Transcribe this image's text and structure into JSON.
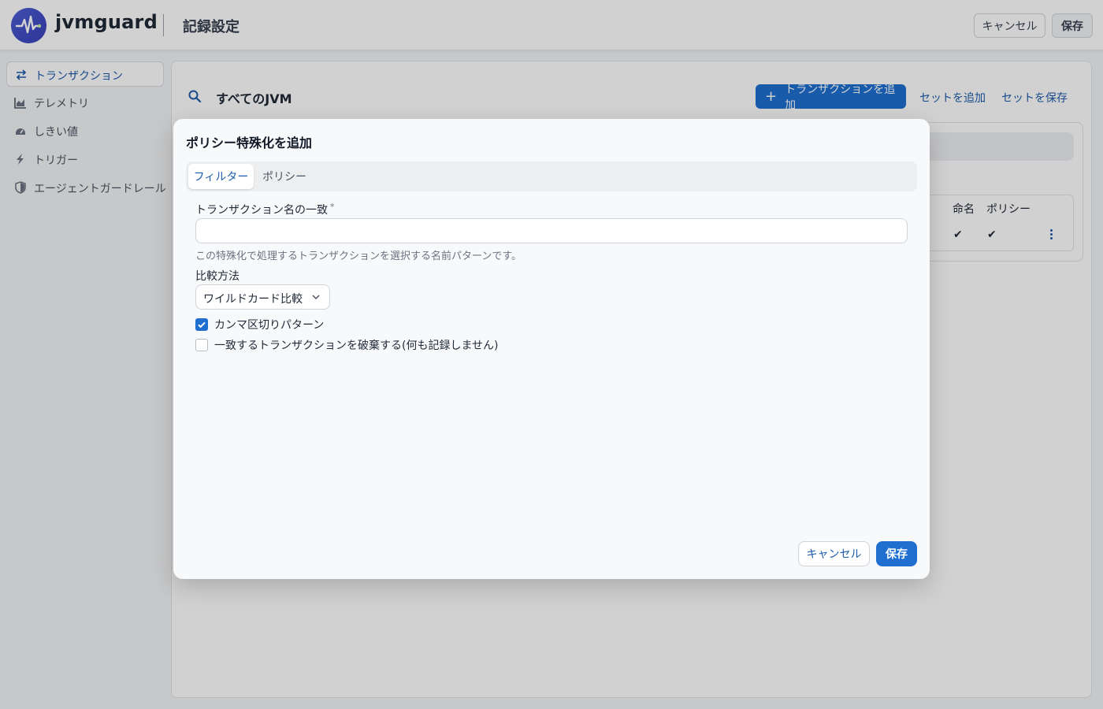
{
  "app": {
    "brand": "jvmguard",
    "page_title": "記録設定"
  },
  "header": {
    "cancel_label": "キャンセル",
    "save_label": "保存"
  },
  "sidebar": {
    "items": [
      {
        "label": "トランザクション",
        "icon": "transactions-icon",
        "active": true
      },
      {
        "label": "テレメトリ",
        "icon": "chart-icon",
        "active": false
      },
      {
        "label": "しきい値",
        "icon": "gauge-icon",
        "active": false
      },
      {
        "label": "トリガー",
        "icon": "lightning-icon",
        "active": false
      },
      {
        "label": "エージェントガードレール",
        "icon": "shield-icon",
        "active": false
      }
    ]
  },
  "main": {
    "scope_label": "すべてのJVM",
    "add_transaction_label": "トランザクションを追加",
    "add_set_label": "セットを追加",
    "save_set_label": "セットを保存",
    "table": {
      "headers": [
        "命名",
        "ポリシー"
      ],
      "rows": [
        {
          "naming": "✔",
          "policy": "✔"
        }
      ]
    }
  },
  "modal": {
    "title": "ポリシー特殊化を追加",
    "tabs": [
      {
        "label": "フィルター",
        "active": true
      },
      {
        "label": "ポリシー",
        "active": false
      }
    ],
    "name_match_label": "トランザクション名の一致",
    "required_mark": "*",
    "name_match_value": "",
    "name_match_help": "この特殊化で処理するトランザクションを選択する名前パターンです。",
    "compare_label": "比較方法",
    "compare_value": "ワイルドカード比較",
    "checkbox_comma": {
      "label": "カンマ区切りパターン",
      "checked": true
    },
    "checkbox_discard": {
      "label": "一致するトランザクションを破棄する(何も記録しません)",
      "checked": false
    },
    "cancel_label": "キャンセル",
    "save_label": "保存"
  },
  "colors": {
    "accent": "#1f6fd1",
    "link": "#1e5bab",
    "logo": "#3f4fc9"
  }
}
